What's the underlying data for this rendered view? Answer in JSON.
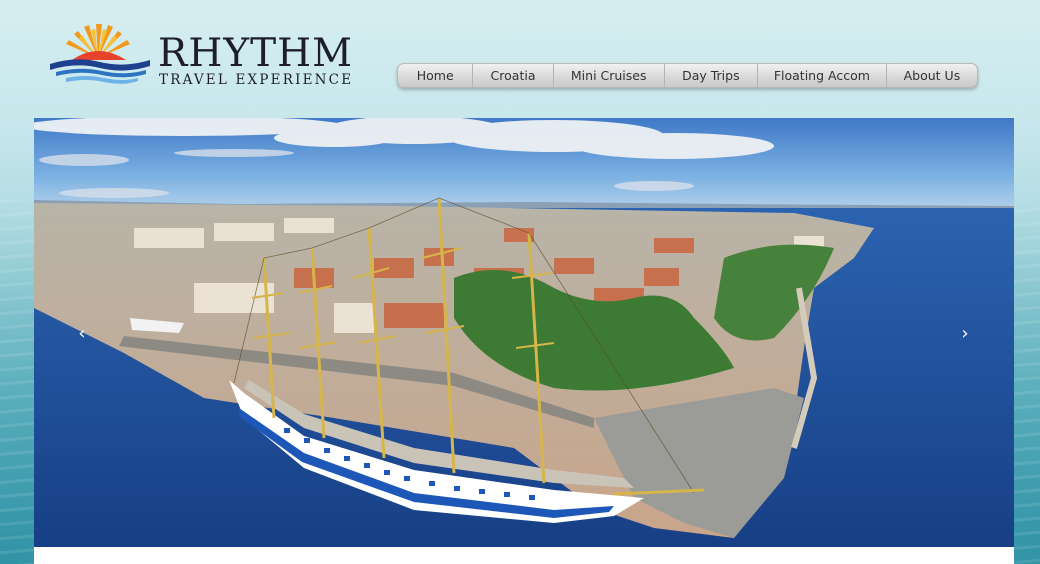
{
  "logo": {
    "word": "RHYTHM",
    "subtitle": "TRAVEL EXPERIENCE",
    "icon": "sun-over-waves-logo-icon"
  },
  "nav": {
    "items": [
      {
        "label": "Home"
      },
      {
        "label": "Croatia"
      },
      {
        "label": "Mini Cruises"
      },
      {
        "label": "Day Trips"
      },
      {
        "label": "Floating Accom"
      },
      {
        "label": "About Us"
      }
    ]
  },
  "slider": {
    "prev_icon": "chevron-left-icon",
    "next_icon": "chevron-right-icon",
    "prev_glyph": "‹",
    "next_glyph": "›",
    "image": "aerial-harbor-tall-ship-photo"
  },
  "colors": {
    "sea": "#1f57a6",
    "sky": "#6fa9de",
    "nav_text": "#333333",
    "logo_text": "#1d1d2e"
  }
}
